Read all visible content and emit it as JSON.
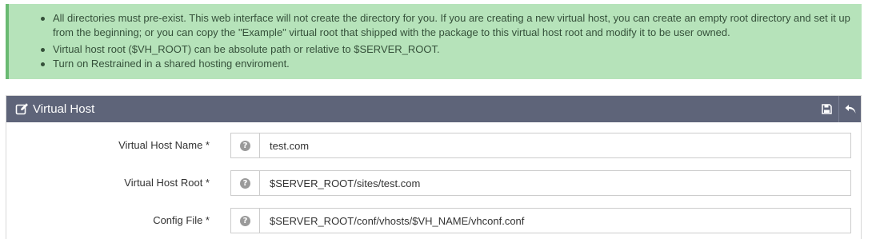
{
  "notice": {
    "items": [
      "All directories must pre-exist. This web interface will not create the directory for you. If you are creating a new virtual host, you can create an empty root directory and set it up from the beginning; or you can copy the \"Example\" virtual root that shipped with the package to this virtual host root and modify it to be user owned.",
      "Virtual host root ($VH_ROOT) can be absolute path or relative to $SERVER_ROOT.",
      "Turn on Restrained in a shared hosting enviroment."
    ]
  },
  "panel": {
    "title": "Virtual Host",
    "icons": {
      "header": "edit-icon",
      "save": "save-icon",
      "back": "undo-icon"
    }
  },
  "form": {
    "help_glyph": "?",
    "fields": [
      {
        "label": "Virtual Host Name *",
        "value": "test.com"
      },
      {
        "label": "Virtual Host Root *",
        "value": "$SERVER_ROOT/sites/test.com"
      },
      {
        "label": "Config File *",
        "value": "$SERVER_ROOT/conf/vhosts/$VH_NAME/vhconf.conf"
      }
    ]
  },
  "colors": {
    "notice_bg": "#b6e3ba",
    "notice_border": "#6aba72",
    "header_bg": "#5e6479"
  }
}
